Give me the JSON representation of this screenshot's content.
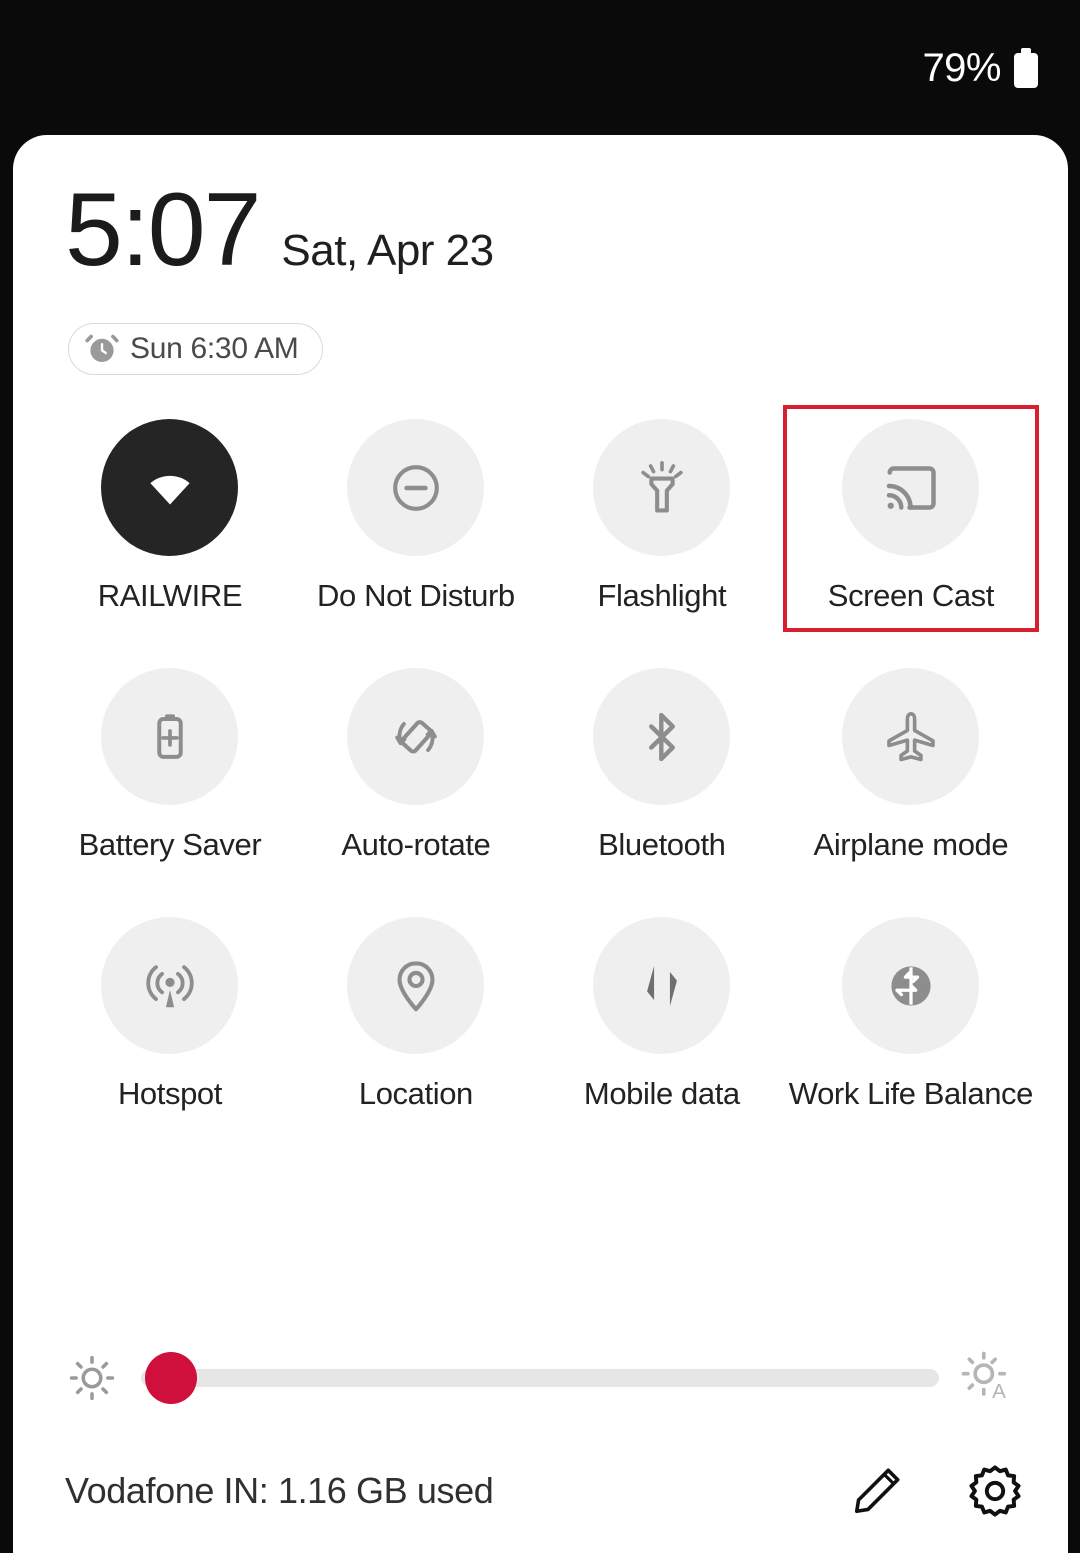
{
  "status_bar": {
    "battery_percent": "79%",
    "battery_icon": "battery-full-icon"
  },
  "panel": {
    "clock": {
      "time": "5:07",
      "date": "Sat, Apr 23"
    },
    "alarm": {
      "icon": "alarm-clock-icon",
      "text": "Sun 6:30 AM"
    },
    "tiles": [
      {
        "label": "RAILWIRE",
        "icon": "wifi-icon",
        "active": true,
        "highlighted": false
      },
      {
        "label": "Do Not Disturb",
        "icon": "do-not-disturb-icon",
        "active": false,
        "highlighted": false
      },
      {
        "label": "Flashlight",
        "icon": "flashlight-icon",
        "active": false,
        "highlighted": false
      },
      {
        "label": "Screen Cast",
        "icon": "screen-cast-icon",
        "active": false,
        "highlighted": true
      },
      {
        "label": "Battery Saver",
        "icon": "battery-saver-icon",
        "active": false,
        "highlighted": false
      },
      {
        "label": "Auto-rotate",
        "icon": "auto-rotate-icon",
        "active": false,
        "highlighted": false
      },
      {
        "label": "Bluetooth",
        "icon": "bluetooth-icon",
        "active": false,
        "highlighted": false
      },
      {
        "label": "Airplane mode",
        "icon": "airplane-icon",
        "active": false,
        "highlighted": false
      },
      {
        "label": "Hotspot",
        "icon": "hotspot-icon",
        "active": false,
        "highlighted": false
      },
      {
        "label": "Location",
        "icon": "location-pin-icon",
        "active": false,
        "highlighted": false
      },
      {
        "label": "Mobile data",
        "icon": "mobile-data-icon",
        "active": false,
        "highlighted": false
      },
      {
        "label": "Work Life Balance",
        "icon": "work-life-balance-icon",
        "active": false,
        "highlighted": false
      }
    ],
    "brightness": {
      "left_icon": "brightness-low-icon",
      "right_icon": "brightness-auto-icon",
      "value_percent": 4
    },
    "footer": {
      "carrier_usage": "Vodafone IN: 1.16 GB used",
      "edit_icon": "pencil-edit-icon",
      "settings_icon": "gear-settings-icon"
    }
  },
  "colors": {
    "highlight": "#d62030",
    "slider_thumb": "#cf0f3c",
    "tile_inactive": "#efefef",
    "tile_active": "#252525",
    "panel_bg": "#ffffff",
    "status_bg": "#0a0a0a"
  }
}
